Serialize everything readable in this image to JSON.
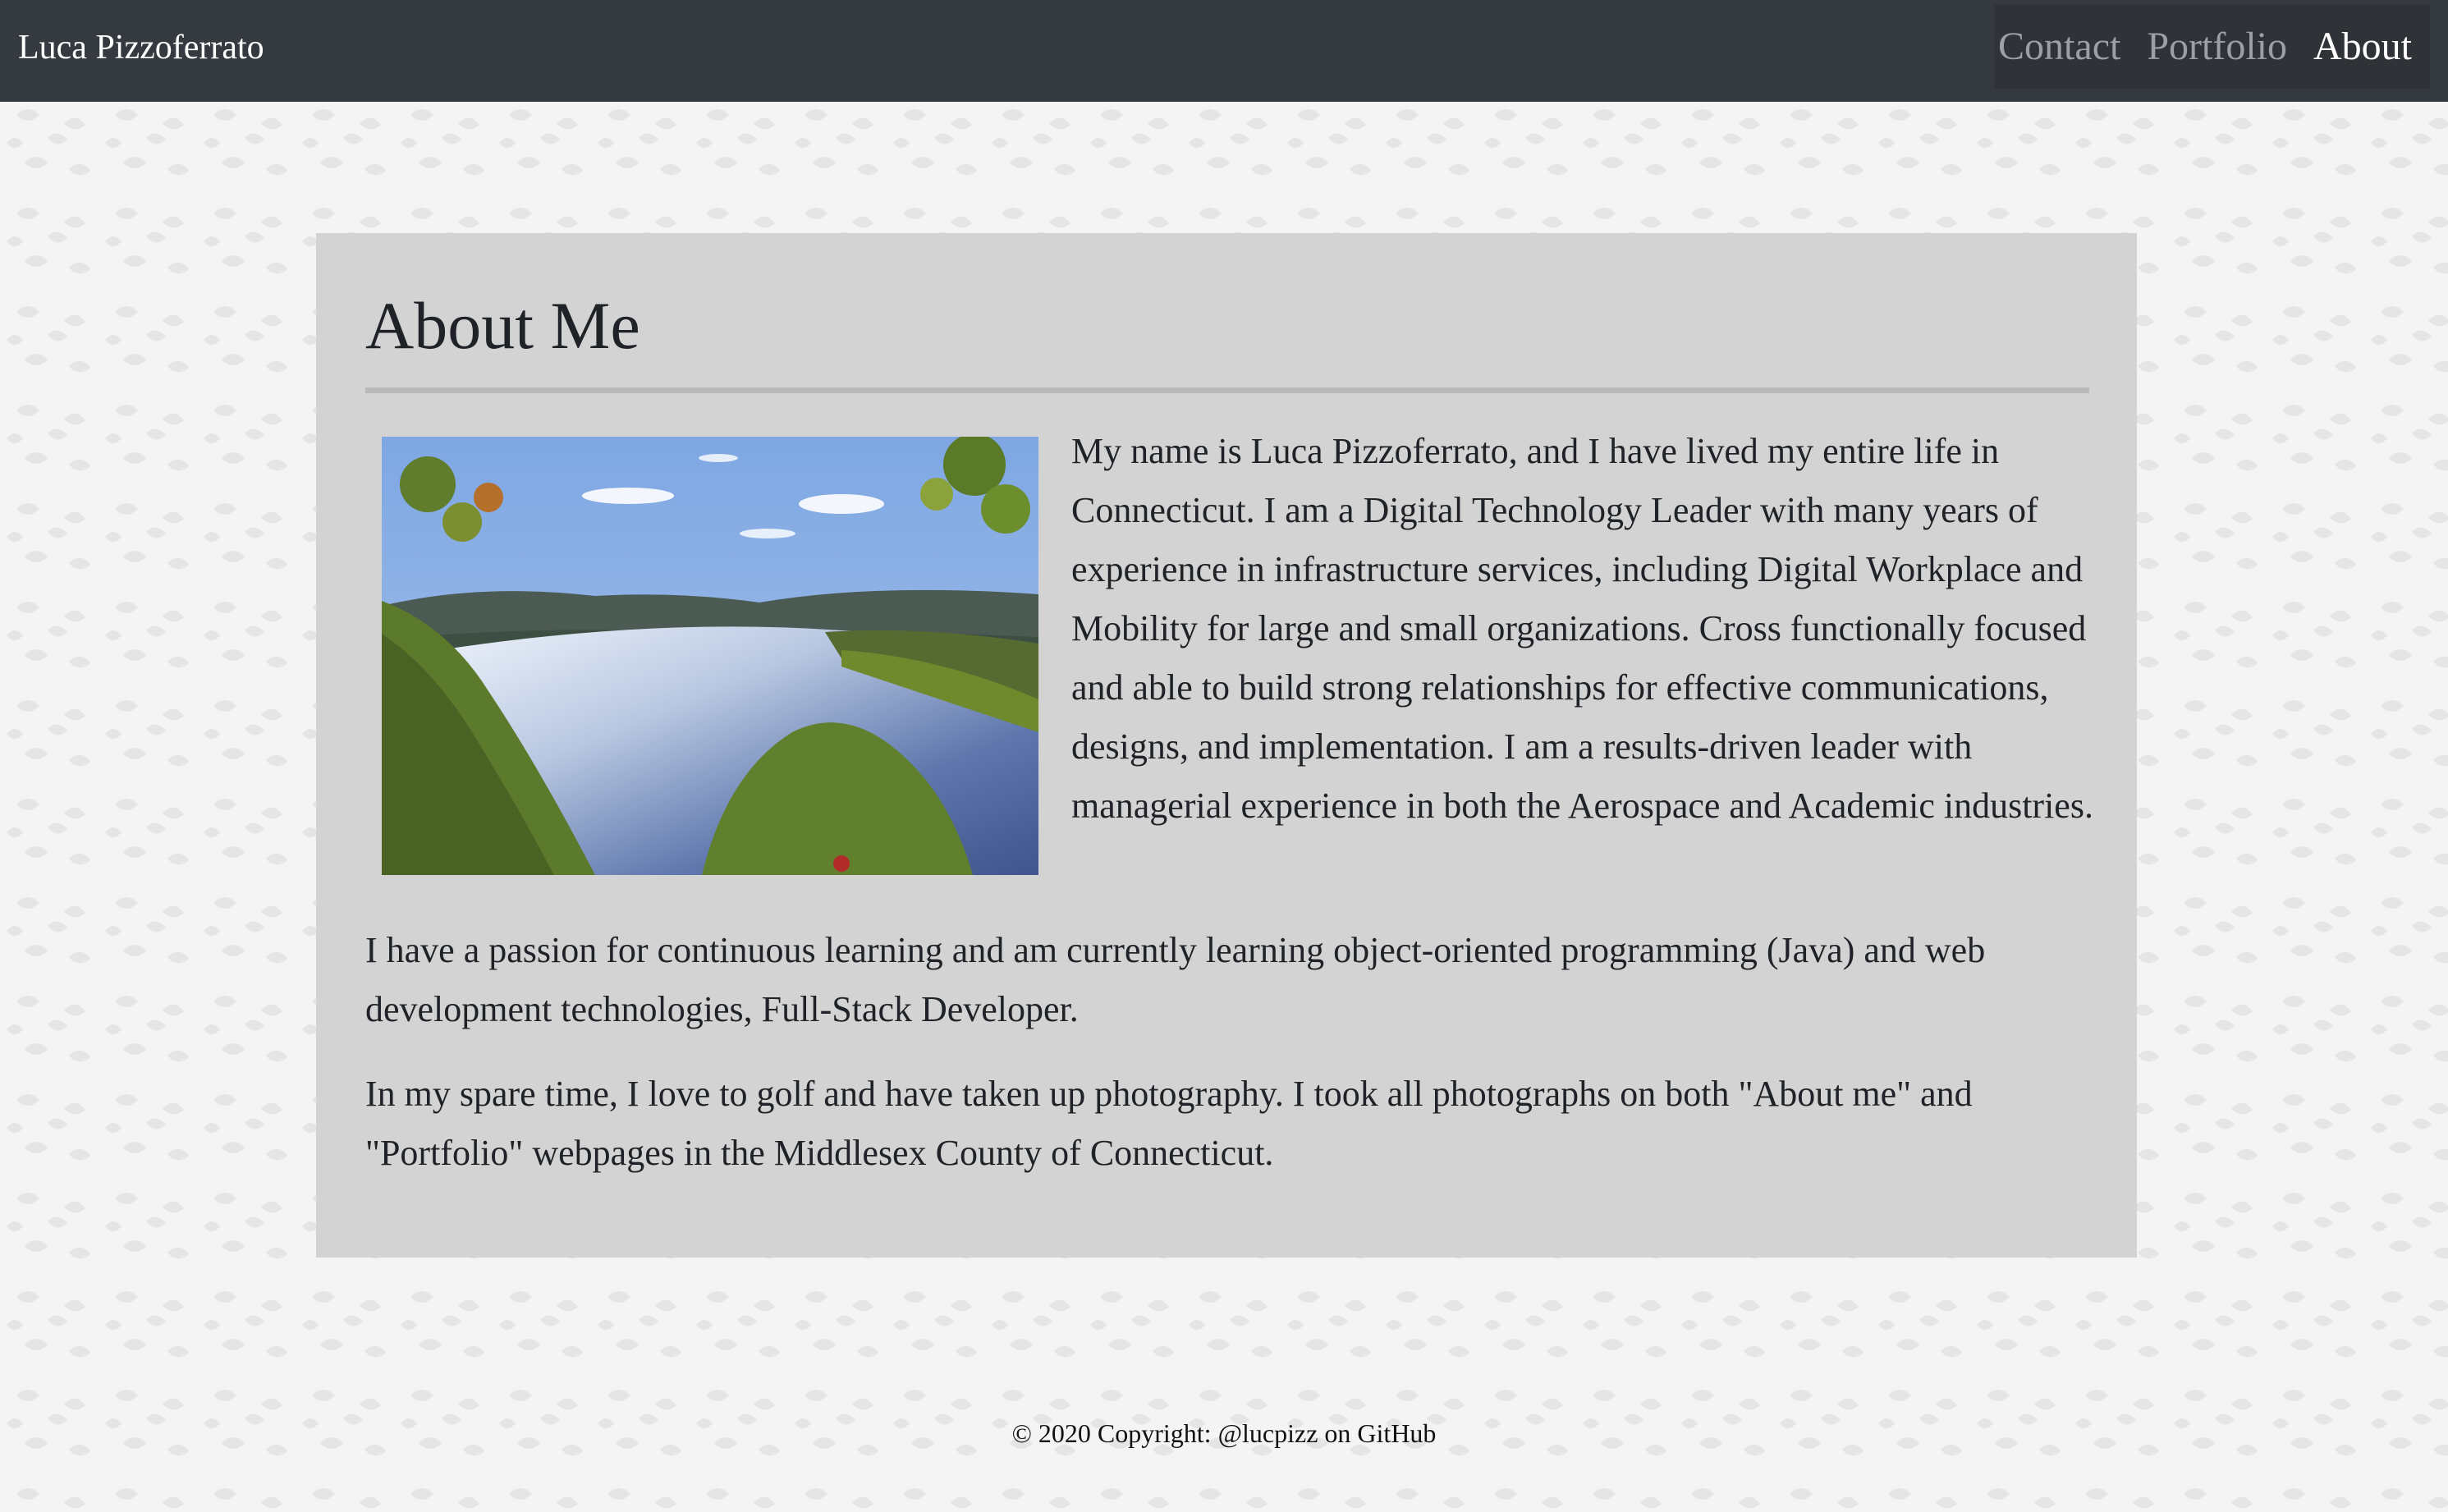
{
  "brand": {
    "name": "Luca Pizzoferrato"
  },
  "nav": {
    "items": [
      {
        "label": "Contact",
        "active": false
      },
      {
        "label": "Portfolio",
        "active": false
      },
      {
        "label": "About",
        "active": true
      }
    ]
  },
  "about": {
    "title": "About Me",
    "paragraphs": [
      "My name is Luca Pizzoferrato, and I have lived my entire life in Connecticut. I am a Digital Technology Leader with many years of experience in infrastructure services, including Digital Workplace and Mobility for large and small organizations. Cross functionally focused and able to build strong relationships for effective communications, designs, and implementation. I am a results-driven leader with managerial experience in both the Aerospace and Academic industries.",
      "I have a passion for continuous learning and am currently learning object-oriented programming (Java) and web development technologies, Full-Stack Developer.",
      "In my spare time, I love to golf and have taken up photography. I took all photographs on both \"About me\" and \"Portfolio\" webpages in the Middlesex County of Connecticut."
    ]
  },
  "footer": {
    "text": "© 2020 Copyright: @lucpizz on GitHub"
  },
  "colors": {
    "navbar": "#343a40",
    "nav_group": "#2f3338",
    "card": "#d3d3d3",
    "rule": "#b9b9b9",
    "pattern_leaf": "#e5e5e5"
  }
}
